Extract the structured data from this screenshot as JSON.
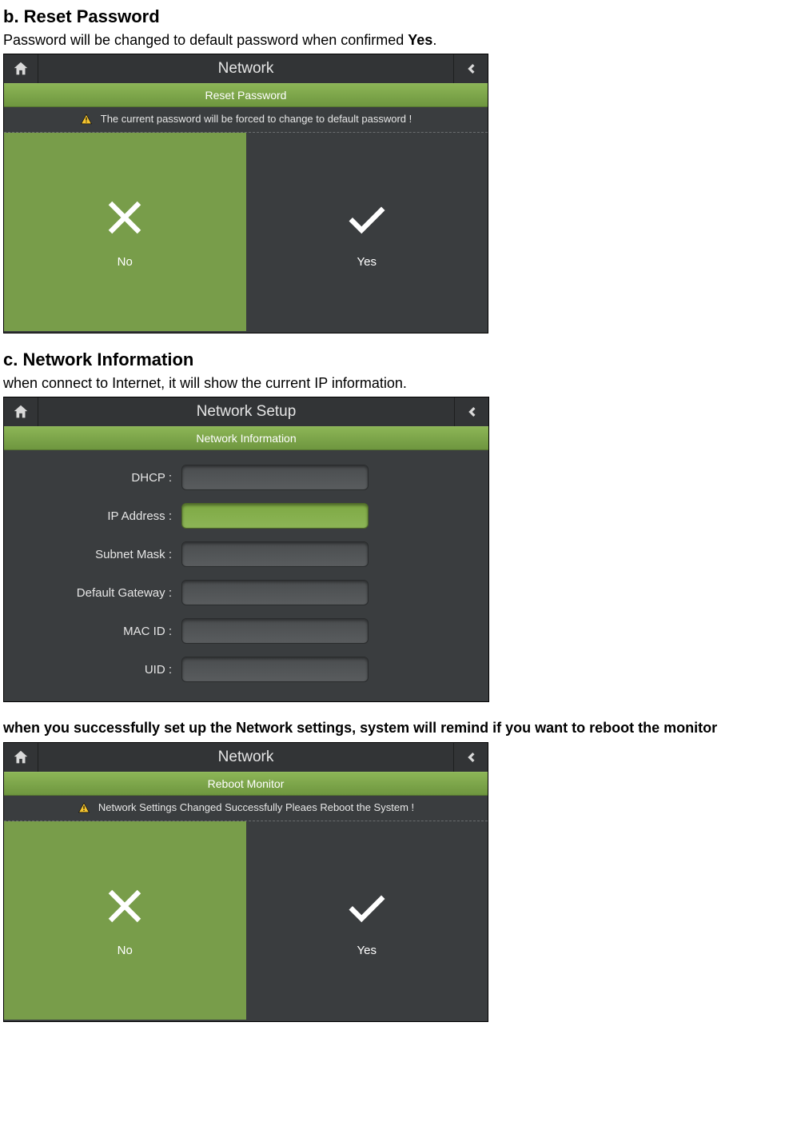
{
  "sections": {
    "reset": {
      "heading": "b. Reset Password",
      "intro_pre": "Password will be changed to default password when confirmed ",
      "intro_bold": "Yes",
      "intro_post": ".",
      "ui": {
        "title": "Network",
        "subtitle": "Reset Password",
        "warning": "The current password will be forced to change to default password !",
        "no": "No",
        "yes": "Yes"
      }
    },
    "netinfo": {
      "heading": "c. Network Information",
      "intro": "when connect to Internet, it will show the current IP information.",
      "ui": {
        "title": "Network Setup",
        "subtitle": "Network Information",
        "fields": {
          "dhcp": "DHCP :",
          "ip": "IP Address :",
          "mask": "Subnet Mask :",
          "gw": "Default Gateway :",
          "mac": "MAC ID :",
          "uid": "UID :"
        }
      }
    },
    "reboot": {
      "intro": "when you successfully set up the Network settings, system will remind if you want to reboot the monitor",
      "ui": {
        "title": "Network",
        "subtitle": "Reboot Monitor",
        "warning": "Network Settings Changed Successfully Pleaes Reboot the System !",
        "no": "No",
        "yes": "Yes"
      }
    }
  }
}
